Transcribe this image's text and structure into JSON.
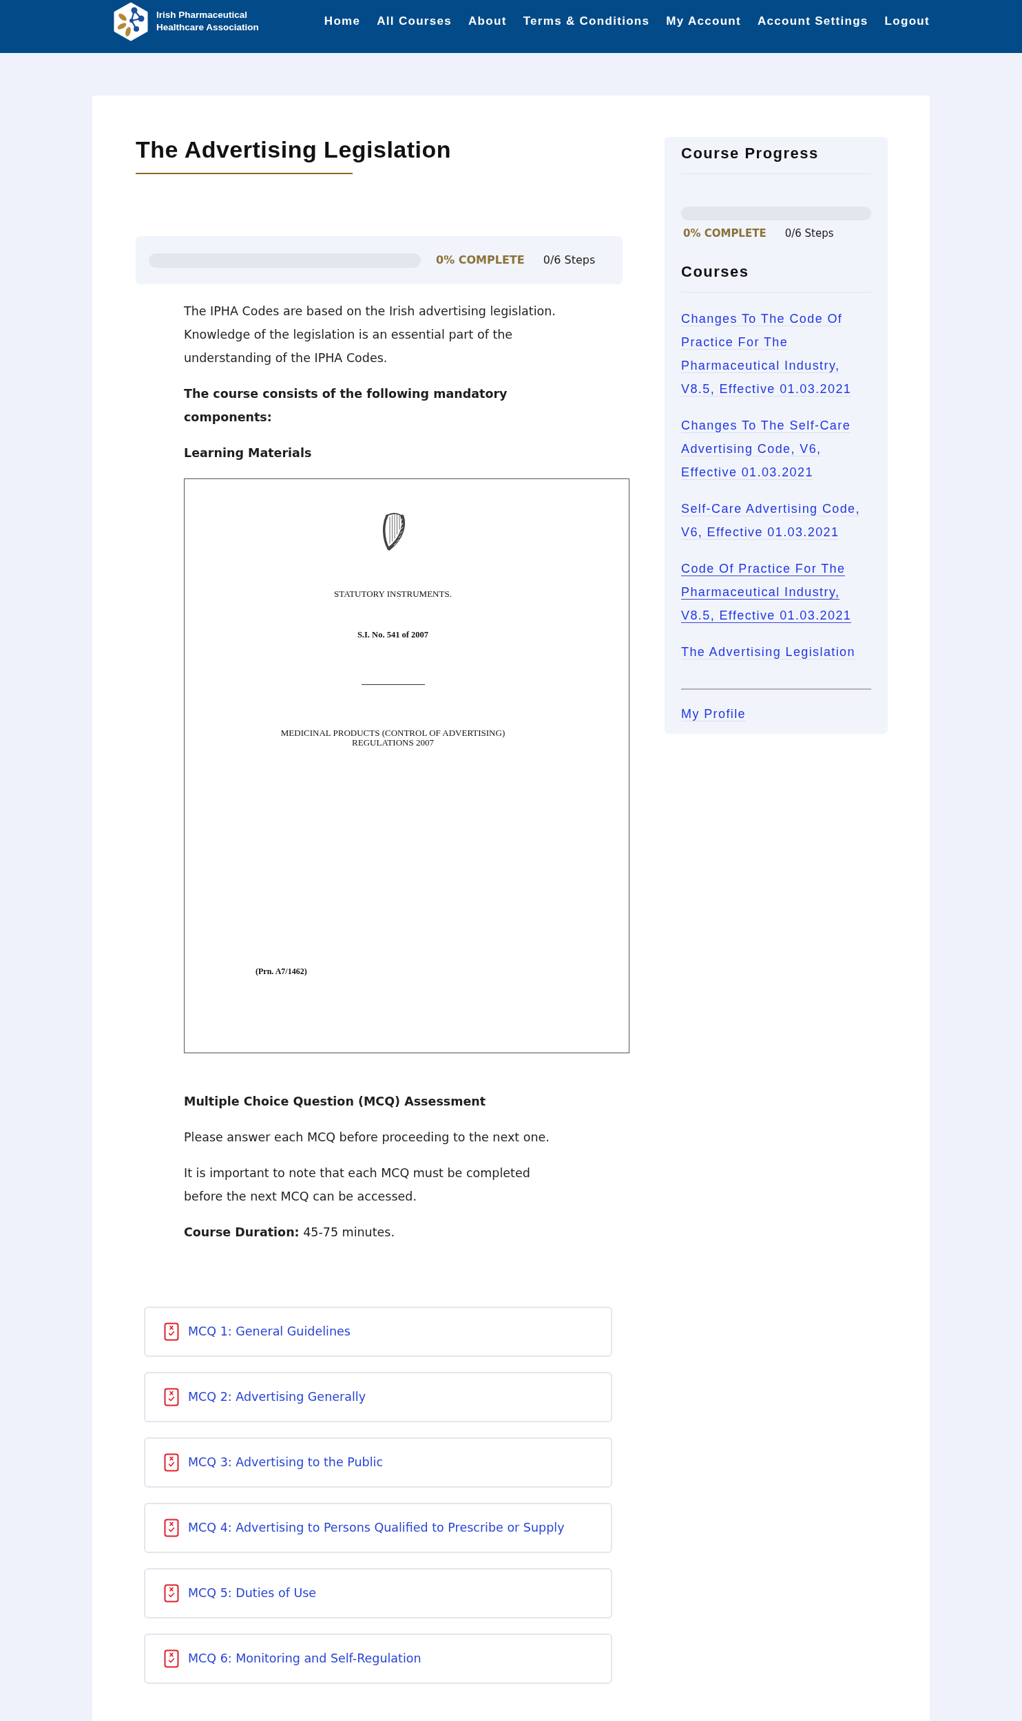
{
  "header": {
    "logo": {
      "lines": [
        "Irish Pharmaceutical",
        "Healthcare Association"
      ]
    },
    "nav": [
      {
        "label": "Home"
      },
      {
        "label": "All Courses"
      },
      {
        "label": "About"
      },
      {
        "label": "Terms & Conditions"
      },
      {
        "label": "My Account"
      },
      {
        "label": "Account Settings"
      },
      {
        "label": "Logout"
      }
    ]
  },
  "course": {
    "title": "The Advertising Legislation",
    "progress": {
      "level": 0,
      "percent": "0% COMPLETE",
      "steps": "0/6 Steps"
    },
    "content": [
      {
        "kind": "paragraph",
        "text": "The IPHA Codes are based on the Irish advertising legislation. Knowledge of the legislation is an essential part of the understanding of the IPHA Codes."
      },
      {
        "kind": "strong",
        "text": "The course consists of the following mandatory components:"
      },
      {
        "kind": "strong",
        "text": "Learning Materials"
      },
      {
        "kind": "document",
        "header": "STATUTORY INSTRUMENTS.",
        "number": "S.I. No. 541 of 2007",
        "title": "MEDICINAL PRODUCTS (CONTROL OF ADVERTISING) REGULATIONS 2007",
        "print_reference": "(Prn. A7/1462)"
      },
      {
        "kind": "strong",
        "text": "Multiple Choice Question (MCQ) Assessment"
      },
      {
        "kind": "paragraph",
        "text": "Please answer each MCQ before proceeding to the next one."
      },
      {
        "kind": "paragraph",
        "text": "It is important to note that each MCQ must be completed before the next MCQ can be accessed."
      },
      {
        "kind": "paragraph",
        "text": "**Course Duration:** 45-75 minutes."
      }
    ],
    "lessons": [
      {
        "label": "MCQ 1: General Guidelines"
      },
      {
        "label": "MCQ 2: Advertising Generally"
      },
      {
        "label": "MCQ 3: Advertising to the Public"
      },
      {
        "label": "MCQ 4: Advertising to Persons Qualified to Prescribe or Supply"
      },
      {
        "label": "MCQ 5: Duties of Use"
      },
      {
        "label": "MCQ 6: Monitoring and Self-Regulation"
      }
    ]
  },
  "sidebar": {
    "progress_title": "Course Progress",
    "progress": {
      "level": 0,
      "percent": "0% COMPLETE",
      "steps": "0/6 Steps"
    },
    "courses_title": "Courses",
    "courses": [
      {
        "label": "Changes To The Code Of Practice For The Pharmaceutical Industry, V8.5, Effective 01.03.2021",
        "hovered": false
      },
      {
        "label": "Changes To The Self-Care Advertising Code, V6, Effective 01.03.2021",
        "hovered": false
      },
      {
        "label": "Self-Care Advertising Code, V6, Effective 01.03.2021",
        "hovered": false
      },
      {
        "label": "Code Of Practice For The Pharmaceutical Industry, V8.5, Effective 01.03.2021",
        "hovered": true
      },
      {
        "label": "The Advertising Legislation",
        "hovered": false
      }
    ],
    "profile_link": "My Profile"
  }
}
